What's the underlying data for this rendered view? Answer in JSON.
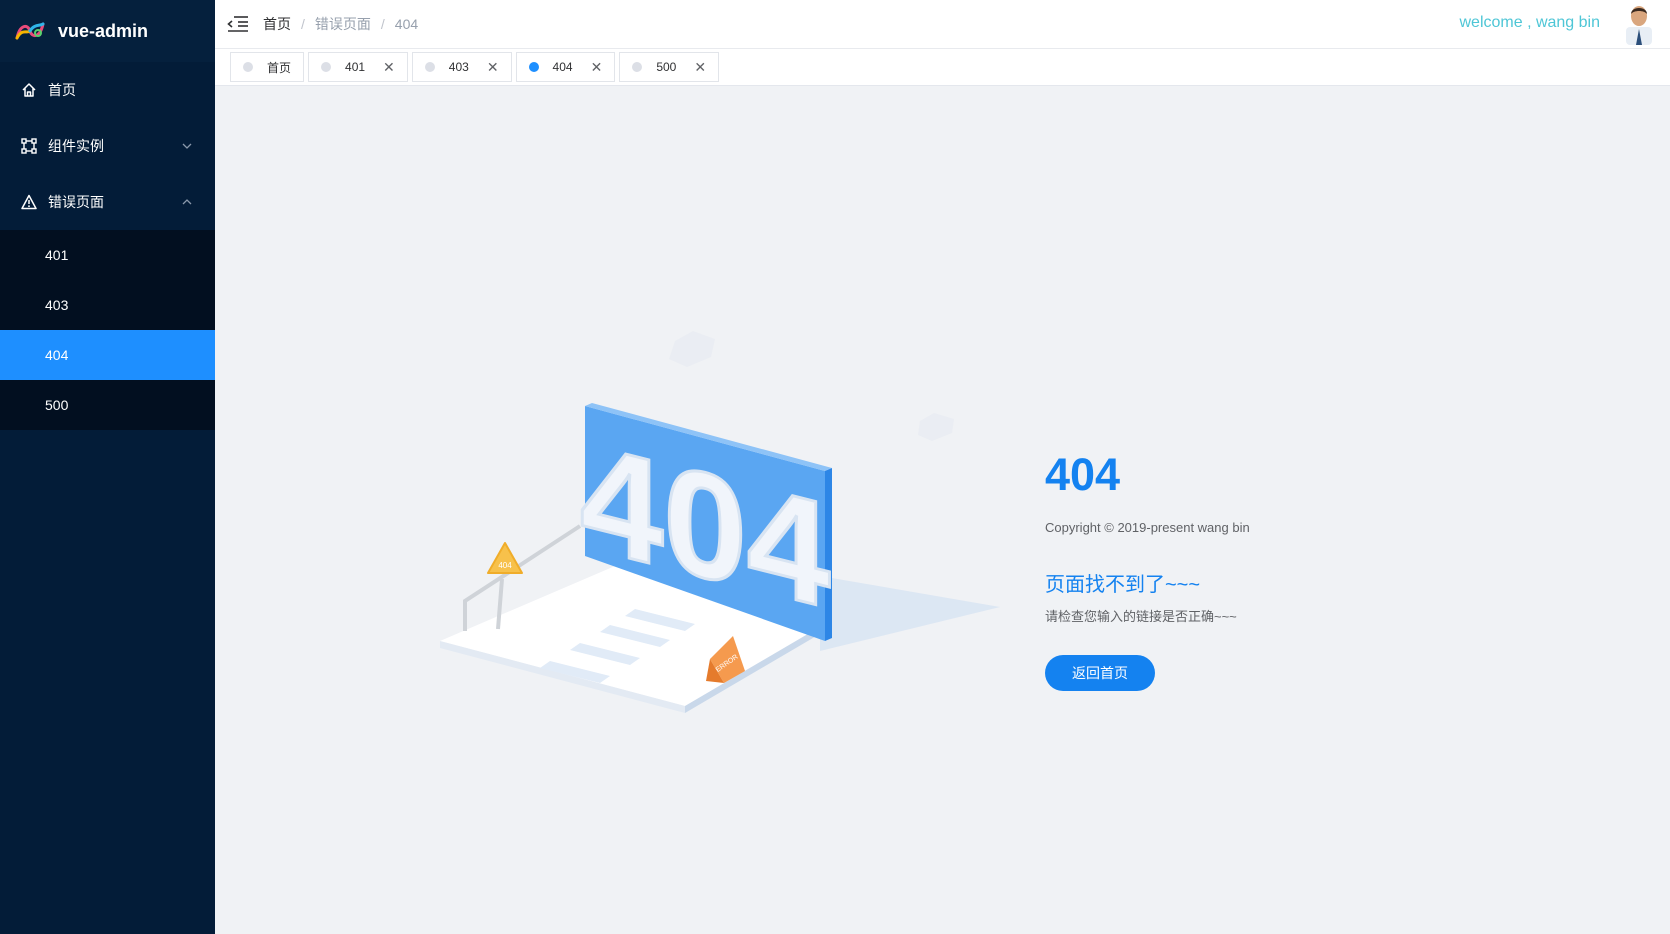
{
  "app": {
    "title": "vue-admin"
  },
  "sidebar": {
    "items": [
      {
        "label": "首页",
        "icon": "home-icon"
      },
      {
        "label": "组件实例",
        "icon": "component-icon",
        "expanded": false
      },
      {
        "label": "错误页面",
        "icon": "warning-icon",
        "expanded": true,
        "children": [
          {
            "label": "401"
          },
          {
            "label": "403"
          },
          {
            "label": "404",
            "active": true
          },
          {
            "label": "500"
          }
        ]
      }
    ]
  },
  "header": {
    "breadcrumb": [
      "首页",
      "错误页面",
      "404"
    ],
    "separator": "/",
    "welcome": "welcome , wang bin"
  },
  "tags": [
    {
      "label": "首页",
      "closable": false
    },
    {
      "label": "401",
      "closable": true
    },
    {
      "label": "403",
      "closable": true
    },
    {
      "label": "404",
      "closable": true,
      "active": true
    },
    {
      "label": "500",
      "closable": true
    }
  ],
  "error_page": {
    "code": "404",
    "copyright": "Copyright © 2019-present wang bin",
    "headline": "页面找不到了~~~",
    "info": "请检查您输入的链接是否正确~~~",
    "back_button": "返回首页",
    "illustration": {
      "big_text": "404",
      "sign_text": "404",
      "cone_text": "ERROR"
    }
  },
  "colors": {
    "sidebar_bg": "#031c38",
    "submenu_bg": "#020f20",
    "accent": "#1e8fff",
    "brand_blue": "#1482f0",
    "welcome": "#4ec6d6",
    "page_bg": "#f0f2f5"
  },
  "close_glyph": "✕"
}
